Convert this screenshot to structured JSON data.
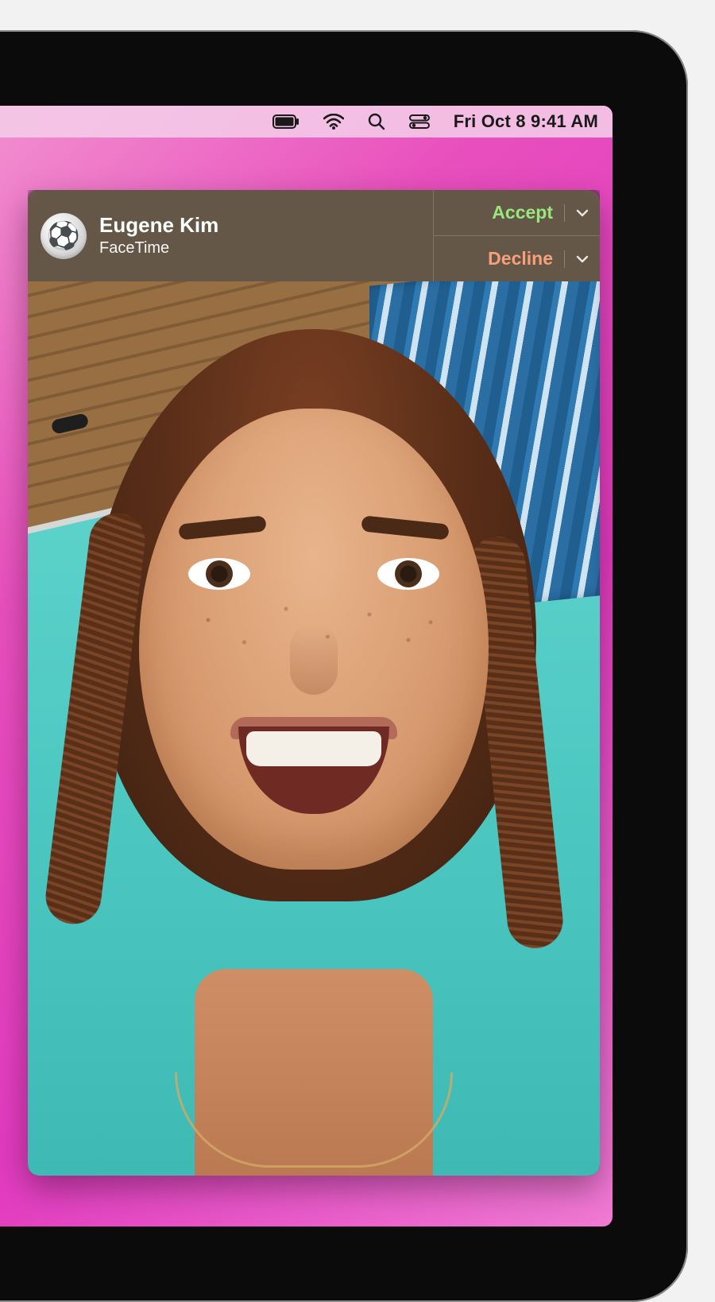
{
  "menubar": {
    "datetime": "Fri Oct 8  9:41 AM",
    "icons": {
      "battery": "battery-icon",
      "wifi": "wifi-icon",
      "search": "search-icon",
      "control_center": "control-center-icon"
    }
  },
  "call": {
    "caller_name": "Eugene Kim",
    "app_name": "FaceTime",
    "avatar_emoji": "⚽",
    "accept_label": "Accept",
    "decline_label": "Decline"
  },
  "colors": {
    "accept": "#9ae67d",
    "decline": "#f7a07a",
    "bar_bg": "rgba(118,102,84,0.85)"
  }
}
